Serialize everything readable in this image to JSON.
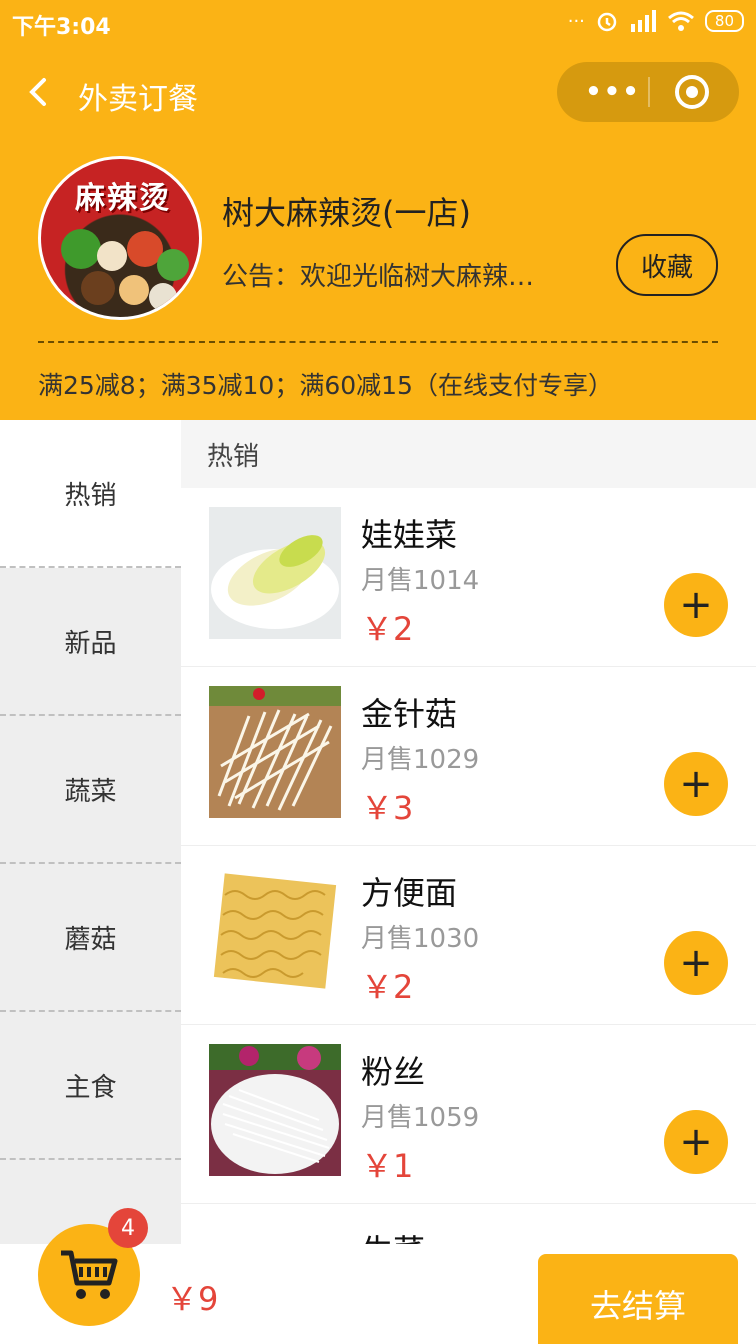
{
  "status": {
    "time": "下午3:04",
    "battery": "80"
  },
  "nav": {
    "title": "外卖订餐",
    "more": "•••"
  },
  "shop": {
    "logo_text": "麻辣烫",
    "name": "树大麻辣烫(一店)",
    "notice": "公告：欢迎光临树大麻辣…",
    "favorite_label": "收藏",
    "promo": "满25减8；满35减10；满60减15（在线支付专享）"
  },
  "categories": [
    "热销",
    "新品",
    "蔬菜",
    "蘑菇",
    "主食"
  ],
  "section_title": "热销",
  "items": [
    {
      "name": "娃娃菜",
      "sold": "月售1014",
      "price": "￥2"
    },
    {
      "name": "金针菇",
      "sold": "月售1029",
      "price": "￥3"
    },
    {
      "name": "方便面",
      "sold": "月售1030",
      "price": "￥2"
    },
    {
      "name": "粉丝",
      "sold": "月售1059",
      "price": "￥1"
    },
    {
      "name": "生菜",
      "sold": "",
      "price": ""
    }
  ],
  "cart": {
    "count": "4",
    "total": "￥9",
    "checkout_label": "去结算"
  },
  "colors": {
    "accent": "#fbb315",
    "price": "#e4453a",
    "badge": "#e4453a"
  }
}
